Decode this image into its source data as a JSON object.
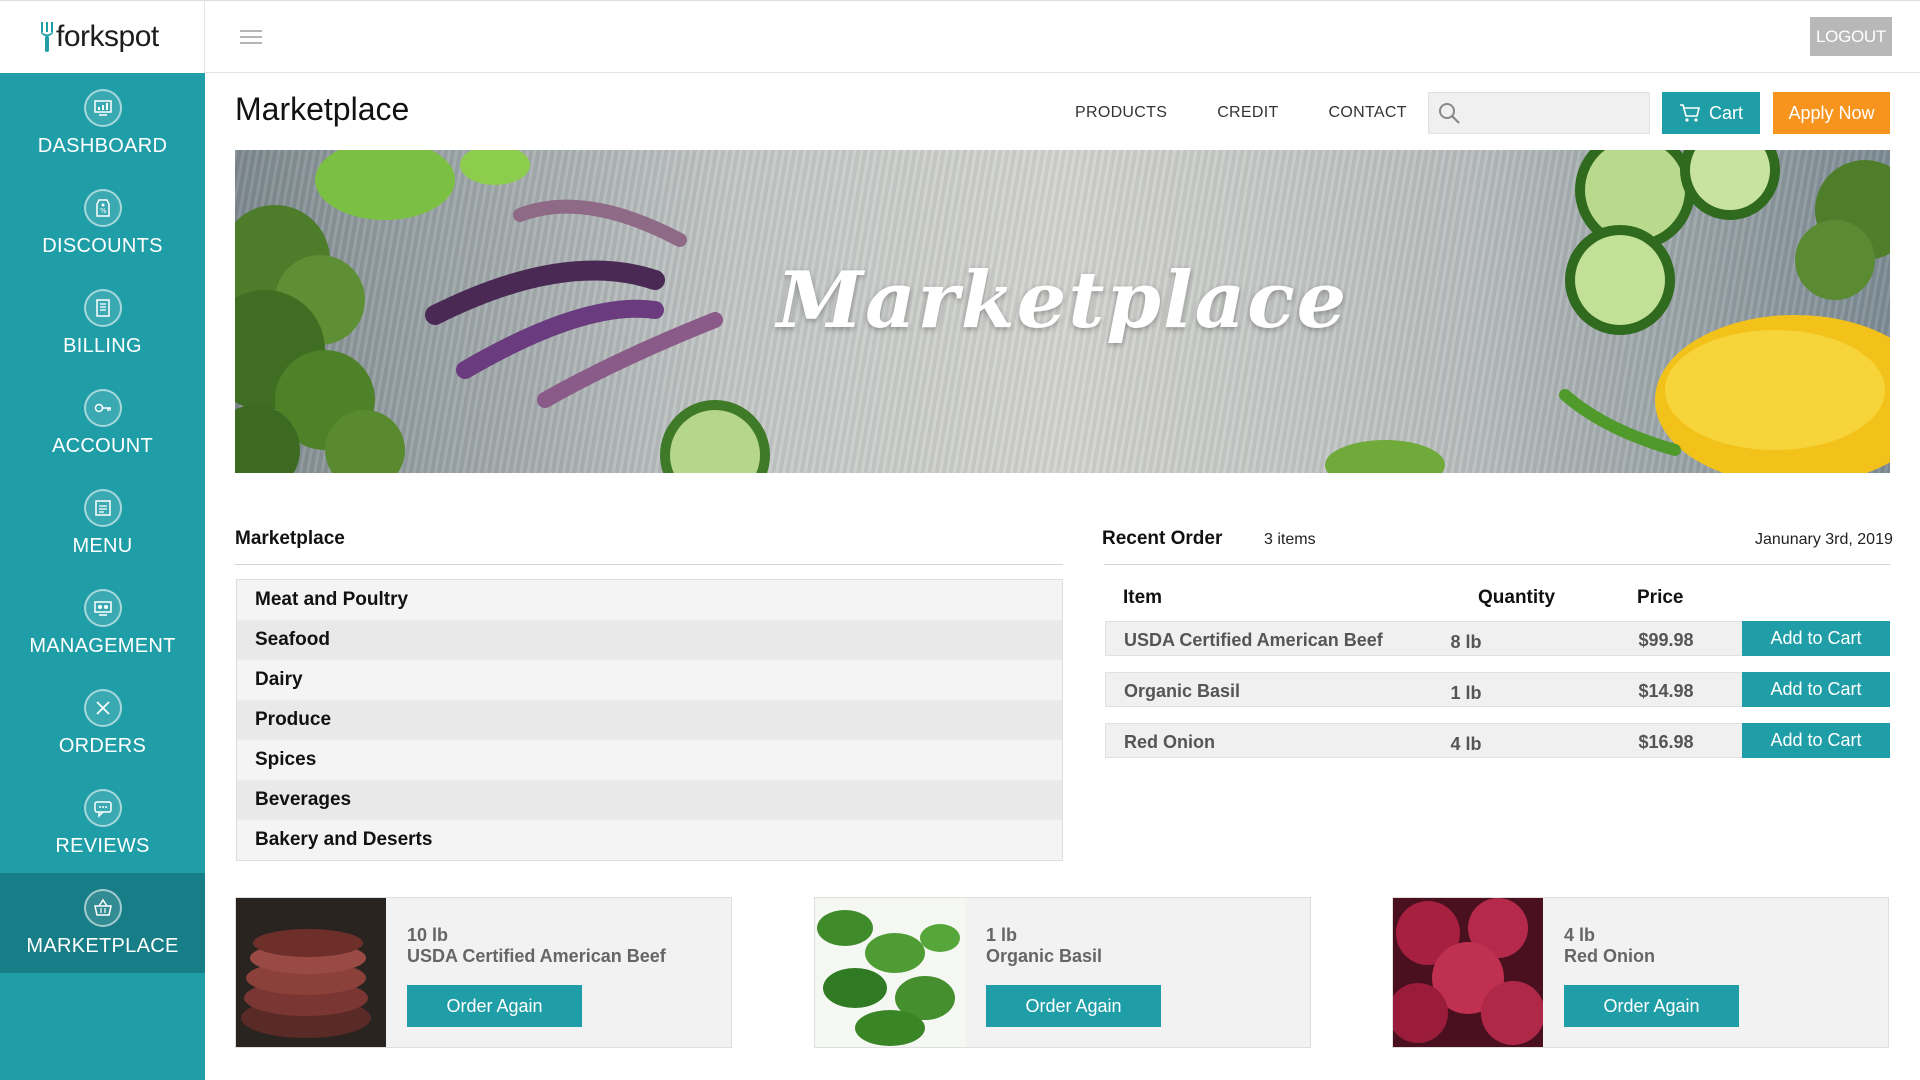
{
  "brand": {
    "logo_text": "forkspot"
  },
  "sidebar": {
    "items": [
      {
        "label": "DASHBOARD",
        "icon": "dashboard-icon"
      },
      {
        "label": "DISCOUNTS",
        "icon": "discount-tag-icon"
      },
      {
        "label": "BILLING",
        "icon": "billing-icon"
      },
      {
        "label": "ACCOUNT",
        "icon": "key-icon"
      },
      {
        "label": "MENU",
        "icon": "menu-book-icon"
      },
      {
        "label": "MANAGEMENT",
        "icon": "management-icon"
      },
      {
        "label": "ORDERS",
        "icon": "utensils-icon"
      },
      {
        "label": "REVIEWS",
        "icon": "review-chat-icon"
      },
      {
        "label": "MARKETPLACE",
        "icon": "basket-icon",
        "active": true
      }
    ]
  },
  "topbar": {
    "logout_label": "LOGOUT"
  },
  "header": {
    "title": "Marketplace",
    "nav": [
      "PRODUCTS",
      "CREDIT",
      "CONTACT"
    ],
    "search_placeholder": "",
    "cart_label": "Cart",
    "apply_label": "Apply Now"
  },
  "hero": {
    "title": "Marketplace"
  },
  "marketplace": {
    "title": "Marketplace",
    "categories": [
      "Meat and Poultry",
      "Seafood",
      "Dairy",
      "Produce",
      "Spices",
      "Beverages",
      "Bakery and Deserts"
    ]
  },
  "recent_order": {
    "title": "Recent Order",
    "item_count": "3 items",
    "date": "Janunary 3rd, 2019",
    "columns": {
      "item": "Item",
      "quantity": "Quantity",
      "price": "Price"
    },
    "rows": [
      {
        "name": "USDA Certified American Beef",
        "quantity": "8 lb",
        "price": "$99.98",
        "action": "Add to Cart"
      },
      {
        "name": "Organic Basil",
        "quantity": "1 lb",
        "price": "$14.98",
        "action": "Add to Cart"
      },
      {
        "name": "Red Onion",
        "quantity": "4 lb",
        "price": "$16.98",
        "action": "Add to Cart"
      }
    ]
  },
  "reorder_cards": [
    {
      "quantity": "10 lb",
      "name": "USDA Certified American Beef",
      "action": "Order Again"
    },
    {
      "quantity": "1 lb",
      "name": "Organic Basil",
      "action": "Order Again"
    },
    {
      "quantity": "4 lb",
      "name": "Red Onion",
      "action": "Order Again"
    }
  ],
  "colors": {
    "accent": "#1f9ea8",
    "accent_active": "#177d86",
    "apply": "#f7941d",
    "logout": "#b8b8b8"
  }
}
